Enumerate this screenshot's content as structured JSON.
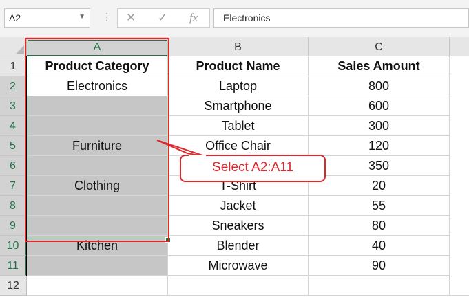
{
  "name_box": {
    "value": "A2"
  },
  "formula_bar": {
    "cancel_icon": "✕",
    "enter_icon": "✓",
    "fx_label": "fx",
    "content": "Electronics"
  },
  "columns": [
    "A",
    "B",
    "C"
  ],
  "rows": [
    "1",
    "2",
    "3",
    "4",
    "5",
    "6",
    "7",
    "8",
    "9",
    "10",
    "11",
    "12"
  ],
  "table": {
    "headers": [
      "Product Category",
      "Product Name",
      "Sales Amount"
    ],
    "data": [
      [
        "Electronics",
        "Laptop",
        "800"
      ],
      [
        "",
        "Smartphone",
        "600"
      ],
      [
        "",
        "Tablet",
        "300"
      ],
      [
        "Furniture",
        "Office Chair",
        "120"
      ],
      [
        "",
        "",
        "350"
      ],
      [
        "Clothing",
        "T-Shirt",
        "20"
      ],
      [
        "",
        "Jacket",
        "55"
      ],
      [
        "",
        "Sneakers",
        "80"
      ],
      [
        "Kitchen",
        "Blender",
        "40"
      ],
      [
        "",
        "Microwave",
        "90"
      ]
    ]
  },
  "callout": {
    "text": "Select A2:A11",
    "color": "#e0272a"
  },
  "colors": {
    "selection_fill": "#c6c6c6",
    "excel_green": "#217346"
  }
}
